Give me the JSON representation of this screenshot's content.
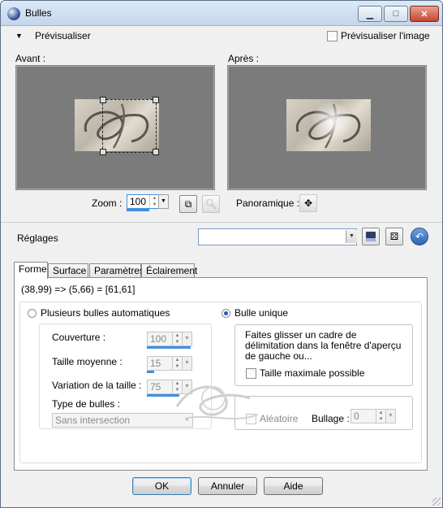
{
  "window": {
    "title": "Bulles"
  },
  "preview": {
    "toggle_label": "Prévisualiser",
    "preview_image_label": "Prévisualiser l'image",
    "preview_image_checked": false,
    "before_label": "Avant :",
    "after_label": "Après :",
    "zoom_label": "Zoom :",
    "zoom_value": "100",
    "pan_label": "Panoramique :"
  },
  "presets": {
    "label": "Réglages",
    "value": ""
  },
  "tabs": [
    {
      "label": "Forme",
      "active": true
    },
    {
      "label": "Surface",
      "active": false
    },
    {
      "label": "Paramètres",
      "active": false
    },
    {
      "label": "Éclairement",
      "active": false
    }
  ],
  "forme": {
    "coords": "(38,99) => (5,66) = [61,61]",
    "auto_bubbles_label": "Plusieurs bulles automatiques",
    "single_bubble_label": "Bulle unique",
    "coverage_label": "Couverture :",
    "coverage_value": "100",
    "avg_size_label": "Taille moyenne :",
    "avg_size_value": "15",
    "size_variation_label": "Variation de la taille :",
    "size_variation_value": "75",
    "bubble_type_label": "Type de bulles :",
    "bubble_type_value": "Sans intersection",
    "instructions": "Faites glisser un cadre de délimitation dans la fenêtre d'aperçu de gauche ou...",
    "max_size_label": "Taille maximale possible",
    "random_label": "Aléatoire",
    "bubbling_label": "Bullage :",
    "bubbling_value": "0"
  },
  "footer": {
    "ok_label": "OK",
    "cancel_label": "Annuler",
    "help_label": "Aide"
  },
  "colors": {
    "accent": "#3f8fe0",
    "preview_bg": "#7b7b7b"
  }
}
